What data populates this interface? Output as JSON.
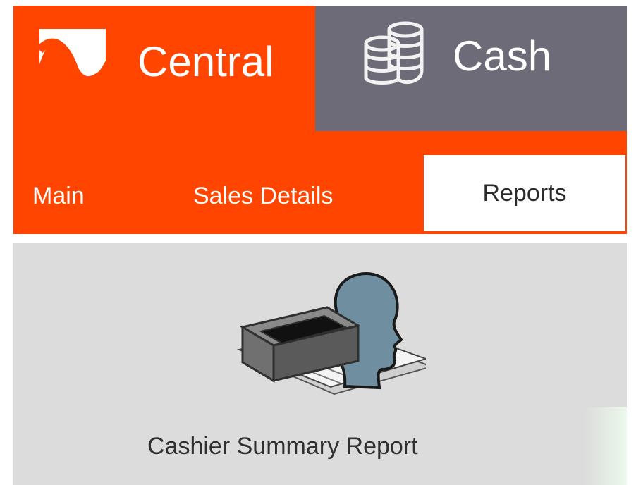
{
  "header": {
    "central_label": "Central",
    "cash_label": "Cash"
  },
  "tabs": [
    {
      "label": "Main"
    },
    {
      "label": "Sales Details"
    },
    {
      "label": "Reports"
    }
  ],
  "content": {
    "report_label": "Cashier Summary Report"
  },
  "colors": {
    "brand_orange": "#ff4500",
    "gray_header": "#6c6b77",
    "panel_bg": "#dcdcdc"
  },
  "icons": [
    "central-logo-icon",
    "coins-stack-icon",
    "cashier-summary-report-icon"
  ]
}
